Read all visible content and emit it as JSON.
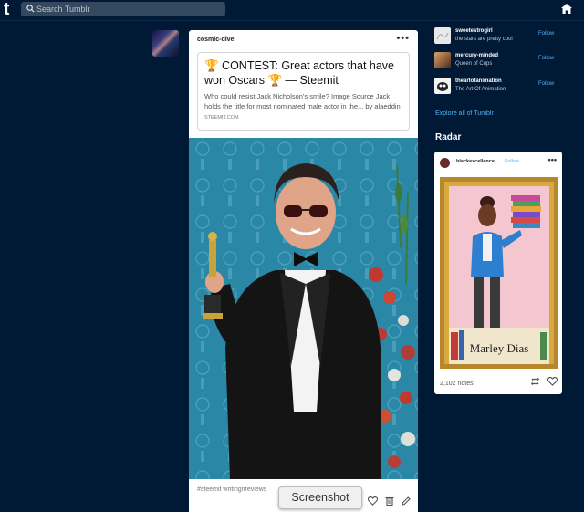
{
  "header": {
    "logo": "t",
    "search_placeholder": "Search Tumblr"
  },
  "post": {
    "blog_name": "cosmic-dive",
    "link_title": "🏆 CONTEST: Great actors that have won Oscars 🏆 — Steemit",
    "link_description": "Who could resist Jack Nicholson's smile? Image Source Jack holds the title for most nominated male actor in the... by alaeddin",
    "link_site": "STEEMIT.COM",
    "tags": "#steemit  writingnreviews"
  },
  "tooltip": "Screenshot",
  "sidebar": {
    "suggestions": [
      {
        "name": "sweetestrogirl",
        "subtitle": "the stars are pretty cool",
        "follow": "Follow"
      },
      {
        "name": "mercury-minded",
        "subtitle": "Queen of Cups",
        "follow": "Follow"
      },
      {
        "name": "theartofanimation",
        "subtitle": "The Art Of Animation",
        "follow": "Follow"
      }
    ],
    "explore_link": "Explore all of Tumblr",
    "radar_heading": "Radar",
    "radar_post": {
      "blog_name": "blackexcellence",
      "follow": "Follow",
      "image_caption": "Marley Dias",
      "notes": "2,102 notes"
    }
  },
  "colors": {
    "background": "#001935",
    "accent": "#4fb3f6",
    "search_bg": "#34495e"
  }
}
